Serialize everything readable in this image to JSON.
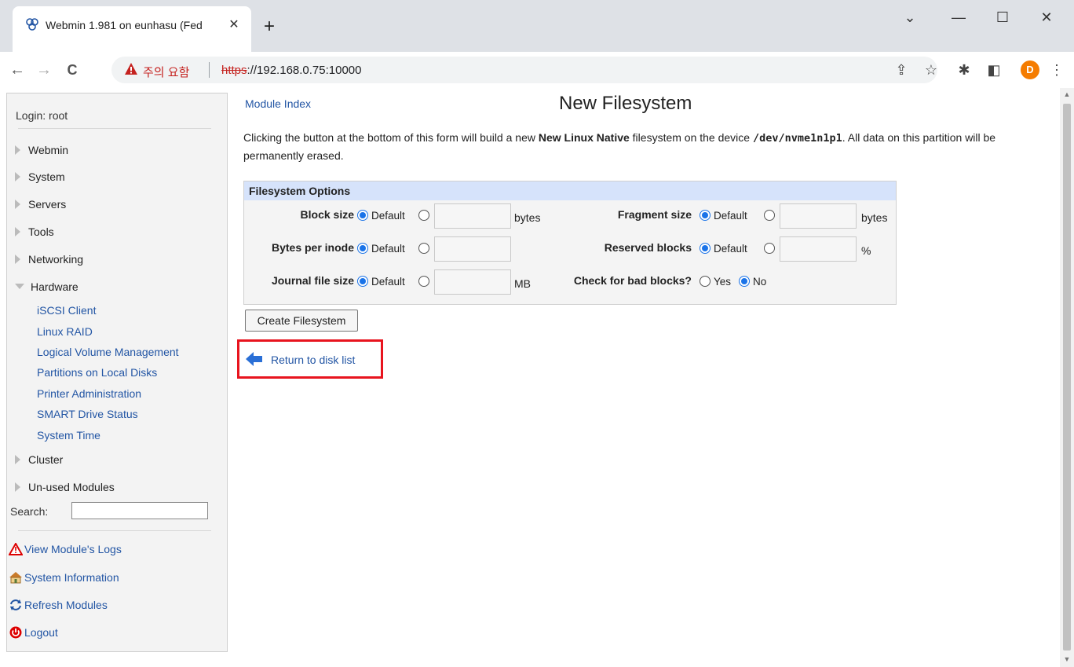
{
  "browser": {
    "tab_title": "Webmin 1.981 on eunhasu (Fed",
    "tab_close": "✕",
    "new_tab": "+",
    "window_controls": {
      "dropdown": "⌄",
      "minimize": "—",
      "maximize": "☐",
      "close": "✕"
    },
    "nav": {
      "back": "←",
      "forward": "→",
      "reload": "C"
    },
    "security_warning": "주의 요함",
    "url_scheme": "https",
    "url_rest": "://192.168.0.75:10000",
    "toolbar_icons": [
      "share-icon",
      "star-icon",
      "extensions-icon",
      "sidepanel-icon",
      "profile-avatar",
      "menu-icon"
    ],
    "avatar_letter": "D"
  },
  "sidebar": {
    "login": "Login: root",
    "categories": [
      {
        "label": "Webmin",
        "open": false
      },
      {
        "label": "System",
        "open": false
      },
      {
        "label": "Servers",
        "open": false
      },
      {
        "label": "Tools",
        "open": false
      },
      {
        "label": "Networking",
        "open": false
      },
      {
        "label": "Hardware",
        "open": true
      },
      {
        "label": "Cluster",
        "open": false
      },
      {
        "label": "Un-used Modules",
        "open": false
      }
    ],
    "hardware_modules": [
      "iSCSI Client",
      "Linux RAID",
      "Logical Volume Management",
      "Partitions on Local Disks",
      "Printer Administration",
      "SMART Drive Status",
      "System Time"
    ],
    "search_label": "Search:",
    "search_value": "",
    "links": {
      "logs": "View Module's Logs",
      "sysinfo": "System Information",
      "refresh": "Refresh Modules",
      "logout": "Logout"
    }
  },
  "main": {
    "module_index": "Module Index",
    "title": "New Filesystem",
    "desc_pre": "Clicking the button at the bottom of this form will build a new ",
    "desc_fs": "New Linux Native",
    "desc_mid": " filesystem on the device ",
    "desc_device": "/dev/nvme1n1p1",
    "desc_post": ". All data on this partition will be permanently erased.",
    "options": {
      "header": "Filesystem Options",
      "block_size": {
        "label": "Block size",
        "default": "Default",
        "unit": "bytes",
        "value": ""
      },
      "fragment_size": {
        "label": "Fragment size",
        "default": "Default",
        "unit": "bytes",
        "value": ""
      },
      "bytes_per_inode": {
        "label": "Bytes per inode",
        "default": "Default",
        "value": ""
      },
      "reserved_blocks": {
        "label": "Reserved blocks",
        "default": "Default",
        "unit": "%",
        "value": ""
      },
      "journal_size": {
        "label": "Journal file size",
        "default": "Default",
        "unit": "MB",
        "value": ""
      },
      "bad_blocks": {
        "label": "Check for bad blocks?",
        "yes": "Yes",
        "no": "No",
        "selected": "No"
      }
    },
    "create_button": "Create Filesystem",
    "return_link": "Return to disk list"
  }
}
